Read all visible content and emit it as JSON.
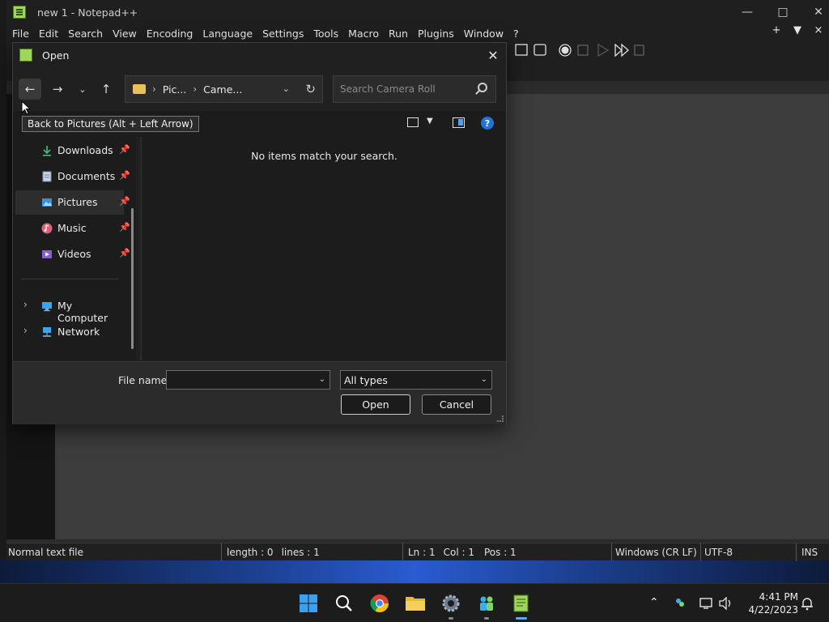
{
  "npp": {
    "title": "new 1 - Notepad++",
    "menu": [
      "File",
      "Edit",
      "Search",
      "View",
      "Encoding",
      "Language",
      "Settings",
      "Tools",
      "Macro",
      "Run",
      "Plugins",
      "Window",
      "?"
    ],
    "menu_right": [
      "+",
      "▼",
      "×"
    ],
    "status": {
      "file_type": "Normal text file",
      "length": "length : 0",
      "lines": "lines : 1",
      "ln": "Ln : 1",
      "col": "Col : 1",
      "pos": "Pos : 1",
      "eol": "Windows (CR LF)",
      "encoding": "UTF-8",
      "mode": "INS"
    }
  },
  "dialog": {
    "title": "Open",
    "breadcrumb": [
      "Pic...",
      "Came..."
    ],
    "search_placeholder": "Search Camera Roll",
    "tooltip": "Back to Pictures (Alt + Left Arrow)",
    "empty_message": "No items match your search.",
    "nav_items": [
      {
        "label": "Downloads",
        "icon": "download-icon",
        "pinned": true
      },
      {
        "label": "Documents",
        "icon": "document-icon",
        "pinned": true
      },
      {
        "label": "Pictures",
        "icon": "pictures-icon",
        "pinned": true,
        "selected": true
      },
      {
        "label": "Music",
        "icon": "music-icon",
        "pinned": true
      },
      {
        "label": "Videos",
        "icon": "video-icon",
        "pinned": true
      },
      {
        "label": "My Computer",
        "icon": "computer-icon",
        "expandable": true
      },
      {
        "label": "Network",
        "icon": "network-icon",
        "expandable": true
      }
    ],
    "file_name_label": "File name:",
    "file_name_value": "",
    "file_type_value": "All types",
    "open_label": "Open",
    "cancel_label": "Cancel"
  },
  "taskbar": {
    "time": "4:41 PM",
    "date": "4/22/2023"
  },
  "colors": {
    "accent": "#1f74d6",
    "folder": "#e8c15a",
    "npp_icon": "#9dd65a"
  }
}
